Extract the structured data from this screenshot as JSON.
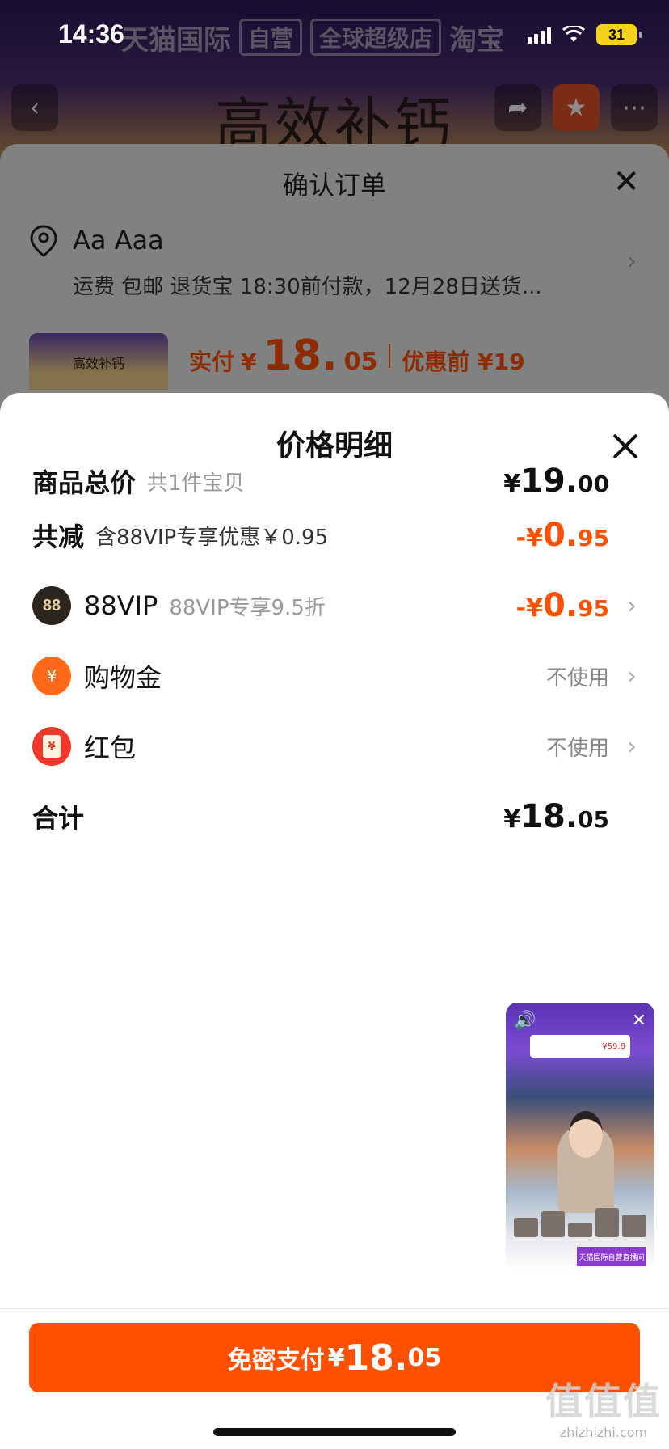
{
  "status_bar": {
    "time": "14:36",
    "battery": "31"
  },
  "background_page": {
    "brand_text": "天猫国际",
    "brand_box_1": "自营",
    "brand_box_2": "全球超级店",
    "brand_right": "淘宝",
    "title": "高效补钙"
  },
  "order_sheet": {
    "title": "确认订单",
    "address_name": "Aa Aaa",
    "address_detail": "运费 包邮 退货宝 18:30前付款，12月28日送货...",
    "product_thumb_text": "高效补钙",
    "paid_label": "实付",
    "paid_currency": "¥",
    "paid_int": "18.",
    "paid_dec": "05",
    "before_discount": "优惠前 ¥19"
  },
  "price_detail": {
    "title": "价格明细",
    "rows": {
      "total": {
        "label": "商品总价",
        "sub": "共1件宝贝",
        "currency": "¥",
        "int": "19.",
        "dec": "00"
      },
      "discount": {
        "label": "共减",
        "sub": "含88VIP专享优惠￥0.95",
        "currency": "-¥",
        "int": "0.",
        "dec": "95"
      },
      "vip": {
        "icon_text": "88",
        "label": "88VIP",
        "sub": "88VIP专享9.5折",
        "currency": "-¥",
        "int": "0.",
        "dec": "95"
      },
      "shopping_gold": {
        "label": "购物金",
        "value": "不使用"
      },
      "red_packet": {
        "icon_text": "¥",
        "label": "红包",
        "value": "不使用"
      },
      "sum": {
        "label": "合计",
        "currency": "¥",
        "int": "18.",
        "dec": "05"
      }
    }
  },
  "live_video": {
    "banner_text": "¥59.8",
    "tag_text": "天猫国际自营直播间"
  },
  "pay_button": {
    "label": "免密支付",
    "currency": "¥",
    "int": "18.",
    "dec": "05"
  },
  "watermark": {
    "logo": "值值值",
    "url": "zhizhizhi.com"
  },
  "colors": {
    "accent": "#ff5000",
    "dim_overlay": "rgba(0,0,0,0.45)"
  }
}
